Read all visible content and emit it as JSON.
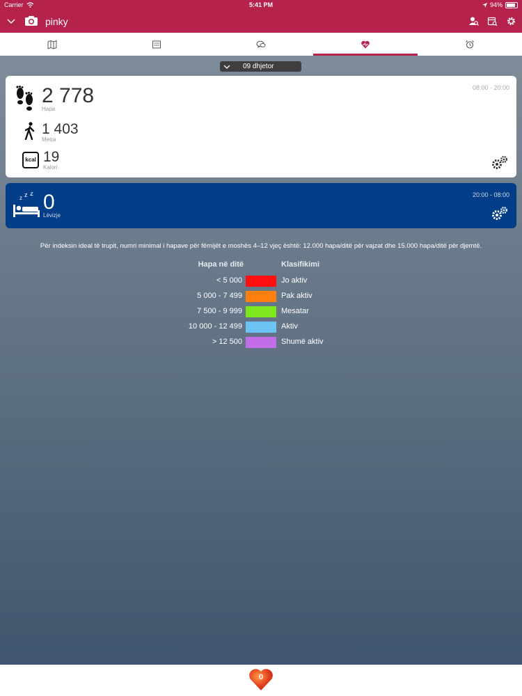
{
  "status": {
    "carrier": "Carrier",
    "time": "5:41 PM",
    "battery": "94%"
  },
  "header": {
    "title": "pinky"
  },
  "date": "09 dhjetor",
  "day": {
    "range": "08:00 - 20:00",
    "steps": {
      "value": "2 778",
      "label": "Hapa"
    },
    "meters": {
      "value": "1 403",
      "label": "Metra"
    },
    "kcal": {
      "value": "19",
      "label": "Kalori"
    },
    "kcal_icon_text": "kcal"
  },
  "night": {
    "range": "20:00 - 08:00",
    "moves": {
      "value": "0",
      "label": "Lëvizje"
    }
  },
  "note": "Për indeksin ideal të trupit, numri minimal i hapave për fëmijët e moshës 4–12 vjeç është: 12.000 hapa/ditë për vajzat dhe 15.000 hapa/ditë për djemtë.",
  "legend": {
    "header_steps": "Hapa në ditë",
    "header_class": "Klasifikimi",
    "rows": [
      {
        "range": "< 5 000",
        "label": "Jo aktiv",
        "color": "#ff0f0f"
      },
      {
        "range": "5 000 - 7 499",
        "label": "Pak aktiv",
        "color": "#ff7f0e"
      },
      {
        "range": "7 500 - 9 999",
        "label": "Mesatar",
        "color": "#7ee81c"
      },
      {
        "range": "10 000 - 12 499",
        "label": "Aktiv",
        "color": "#6cc4f5"
      },
      {
        "range": "> 12 500",
        "label": "Shumë aktiv",
        "color": "#c36ee8"
      }
    ]
  },
  "bottom": {
    "heart_count": "0"
  },
  "colors": {
    "accent": "#b5234d",
    "night": "#023e88"
  }
}
